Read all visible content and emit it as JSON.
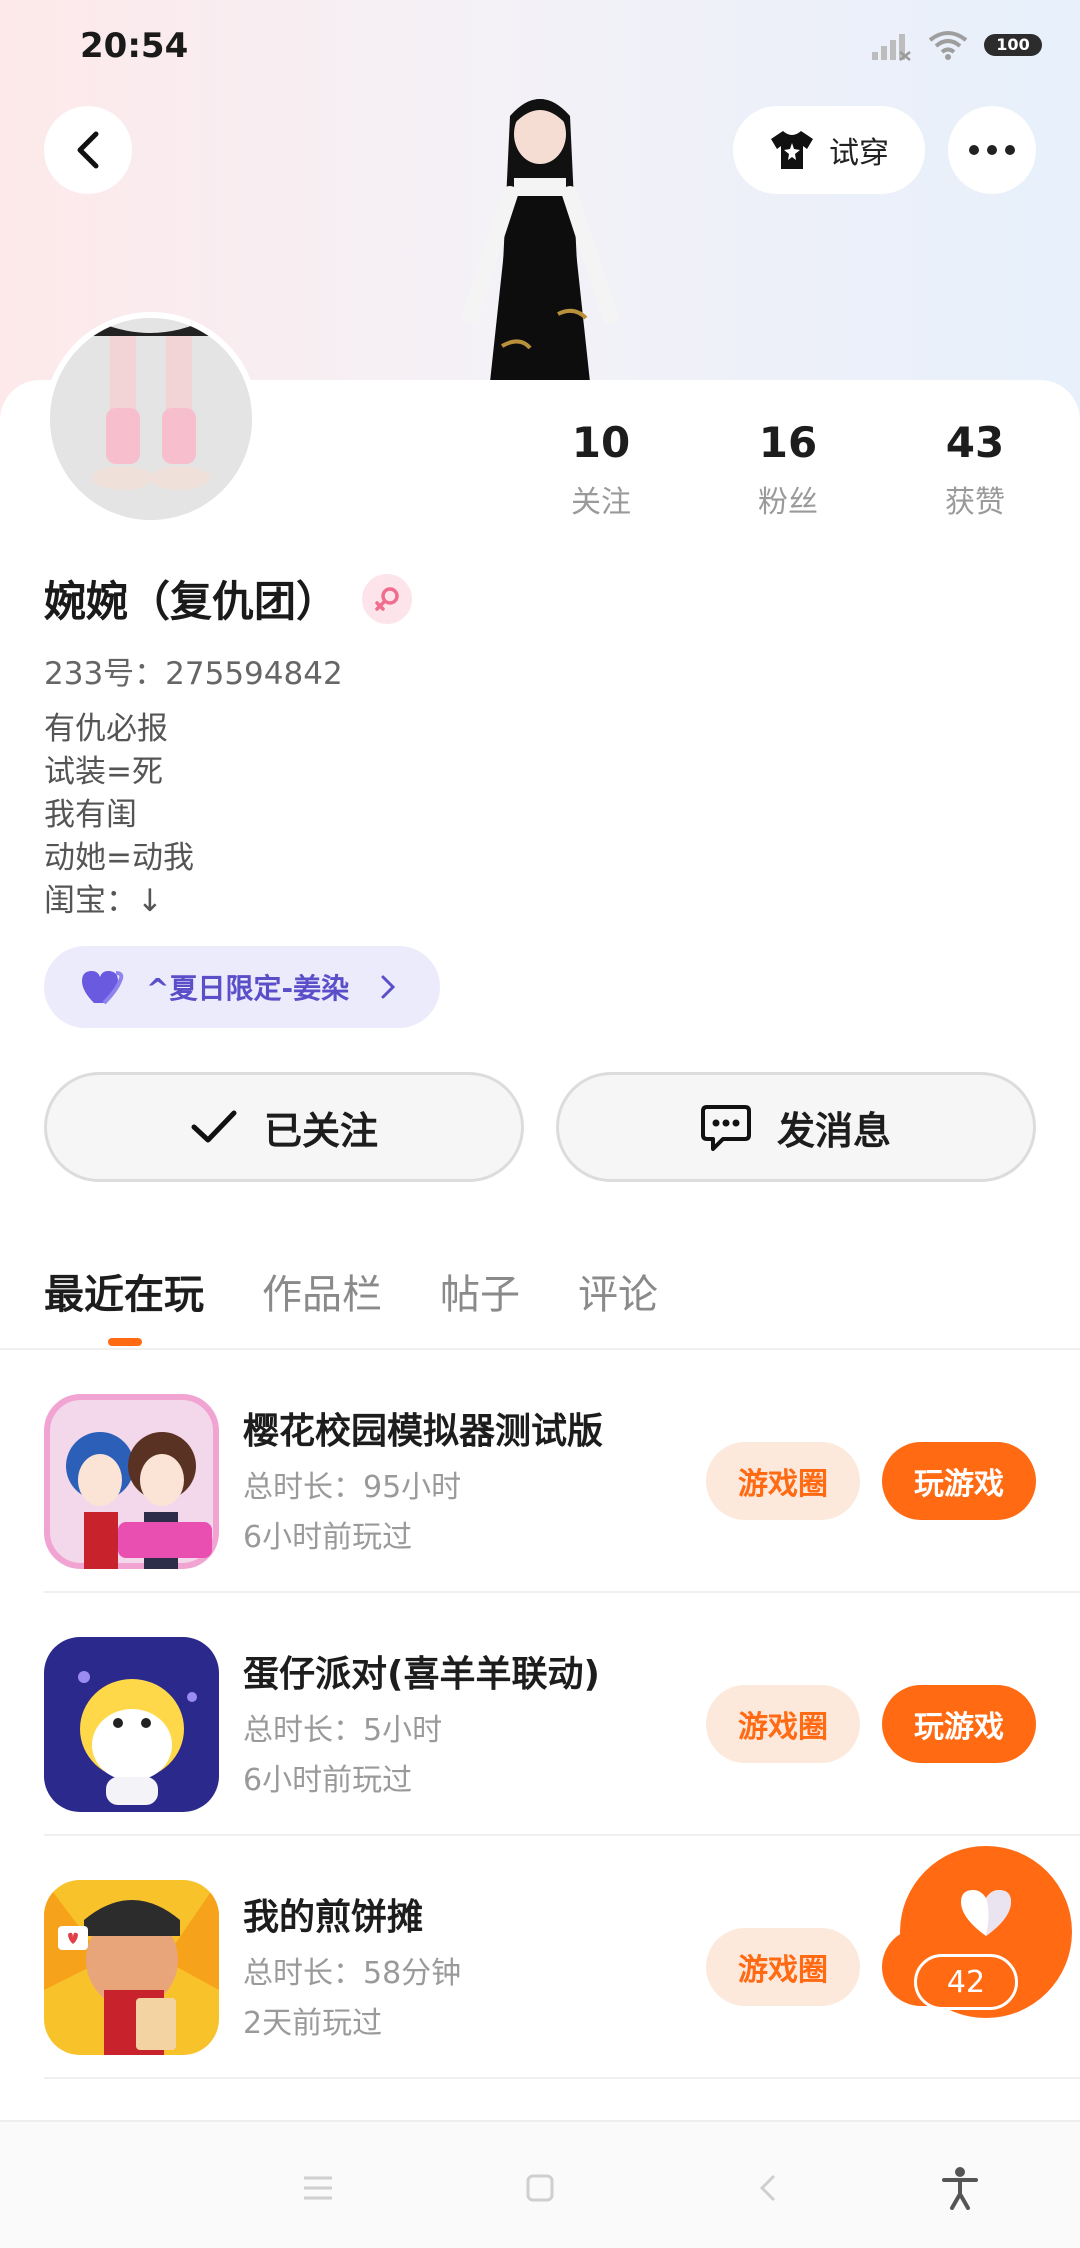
{
  "status_bar": {
    "time": "20:54",
    "battery": "100"
  },
  "header": {
    "tryon_label": "试穿"
  },
  "stats": [
    {
      "value": "10",
      "label": "关注"
    },
    {
      "value": "16",
      "label": "粉丝"
    },
    {
      "value": "43",
      "label": "获赞"
    }
  ],
  "profile": {
    "nickname": "婉婉（复仇团）",
    "user_id": "233号：275594842",
    "bio_lines": [
      "有仇必报",
      "试装=死",
      "我有闺",
      "动她=动我",
      "闺宝：↓"
    ],
    "tag": "^夏日限定-姜染"
  },
  "actions": {
    "followed_label": "已关注",
    "message_label": "发消息"
  },
  "tabs": [
    "最近在玩",
    "作品栏",
    "帖子",
    "评论"
  ],
  "games": [
    {
      "name": "樱花校园模拟器测试版",
      "duration": "总时长：95小时",
      "last_played": "6小时前玩过",
      "circle_label": "游戏圈",
      "play_label": "玩游戏"
    },
    {
      "name": "蛋仔派对(喜羊羊联动)",
      "duration": "总时长：5小时",
      "last_played": "6小时前玩过",
      "circle_label": "游戏圈",
      "play_label": "玩游戏"
    },
    {
      "name": "我的煎饼摊",
      "duration": "总时长：58分钟",
      "last_played": "2天前玩过",
      "circle_label": "游戏圈",
      "play_label": "玩游戏"
    }
  ],
  "like_fab": {
    "count": "42"
  },
  "colors": {
    "accent": "#ff6a13",
    "accent_light": "#fde9dc",
    "tag_bg": "#ecebfb",
    "tag_text": "#5a4fc9"
  },
  "icons": {
    "back": "back-arrow-icon",
    "tryon": "tshirt-icon",
    "more": "more-dots-icon",
    "gender": "female-icon",
    "tag": "heart-icon",
    "followed": "check-icon",
    "message": "chat-bubble-icon",
    "like": "heart-icon"
  }
}
